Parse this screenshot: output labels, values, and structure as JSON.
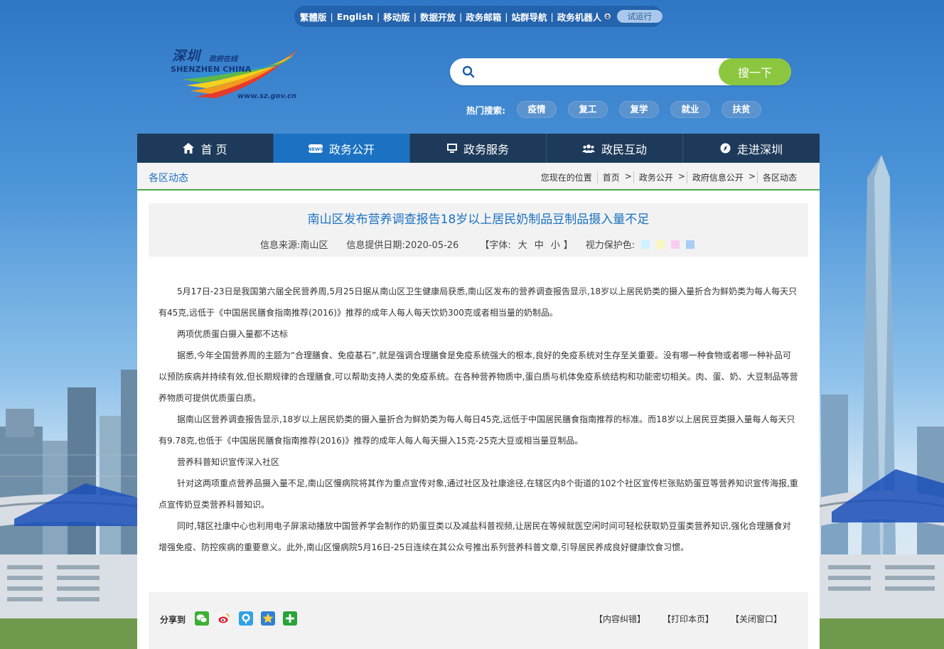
{
  "top_links": {
    "items": [
      "繁體版",
      "English",
      "移动版",
      "数据开放",
      "政务邮箱",
      "站群导航",
      "政务机器人"
    ],
    "trial_badge": "试运行"
  },
  "logo": {
    "chinese_name": "深圳",
    "chinese_sub": "政府在线",
    "english_name": "SHENZHEN CHINA",
    "url": "www.sz.gov.cn"
  },
  "search": {
    "value": "",
    "placeholder": "",
    "button_label": "搜一下",
    "hot_label": "热门搜索:",
    "hot_tags": [
      "疫情",
      "复工",
      "复学",
      "就业",
      "扶贫"
    ]
  },
  "nav": {
    "items": [
      {
        "label": "首 页",
        "icon": "home-icon"
      },
      {
        "label": "政务公开",
        "icon": "news-icon"
      },
      {
        "label": "政务服务",
        "icon": "monitor-icon"
      },
      {
        "label": "政民互动",
        "icon": "people-icon"
      },
      {
        "label": "走进深圳",
        "icon": "compass-icon"
      }
    ],
    "active_index": 1
  },
  "section": {
    "title": "各区动态",
    "breadcrumb_label": "您现在的位置",
    "breadcrumb": [
      "首页",
      "政务公开",
      "政府信息公开",
      "各区动态"
    ]
  },
  "article": {
    "title": "南山区发布营养调查报告18岁以上居民奶制品豆制品摄入量不足",
    "source": "信息来源:南山区",
    "date": "信息提供日期:2020-05-26",
    "font_label": "【字体:",
    "font_sizes": [
      "大",
      "中",
      "小"
    ],
    "font_close": "】",
    "eye_label": "视力保护色:",
    "eye_colors": [
      "#ccf3ff",
      "#f8f7c2",
      "#f9cdf3",
      "#a8cdf5"
    ],
    "paragraphs": [
      "5月17日-23日是我国第六届全民营养周,5月25日据从南山区卫生健康局获悉,南山区发布的营养调查报告显示,18岁以上居民奶类的摄入量折合为鲜奶类为每人每天只有45克,远低于《中国居民膳食指南推荐(2016)》推荐的成年人每人每天饮奶300克或者相当量的奶制品。",
      "两项优质蛋白摄入量都不达标",
      "据悉,今年全国营养周的主题为“合理膳食、免疫基石”,就是强调合理膳食是免疫系统强大的根本,良好的免疫系统对生存至关重要。没有哪一种食物或者哪一种补品可以预防疾病并持续有效,但长期规律的合理膳食,可以帮助支持人类的免疫系统。在各种营养物质中,蛋白质与机体免疫系统结构和功能密切相关。肉、蛋、奶、大豆制品等营养物质可提供优质蛋白质。",
      "据南山区营养调查报告显示,18岁以上居民奶类的摄入量折合为鲜奶类为每人每日45克,远低于中国居民膳食指南推荐的标准。而18岁以上居民豆类摄入量每人每天只有9.78克,也低于《中国居民膳食指南推荐(2016)》推荐的成年人每人每天摄入15克-25克大豆或相当量豆制品。",
      "营养科普知识宣传深入社区",
      "针对这两项重点营养品摄入量不足,南山区慢病院将其作为重点宣传对象,通过社区及社康途径,在辖区内8个街道的102个社区宣传栏张贴奶蛋豆等营养知识宣传海报,重点宣传奶豆类营养科普知识。",
      "同时,辖区社康中心也利用电子屏滚动播放中国营养学会制作的奶蛋豆类以及减盐科普视频,让居民在等候就医空闲时间可轻松获取奶豆蛋类营养知识,强化合理膳食对增强免疫、防控疾病的重要意义。此外,南山区慢病院5月16日-25日连续在其公众号推出系列营养科普文章,引导居民养成良好健康饮食习惯。"
    ]
  },
  "share": {
    "label": "分享到",
    "icons": [
      "wechat-icon",
      "weibo-icon",
      "qzone-icon",
      "star-icon",
      "plus-icon"
    ],
    "links": [
      "【内容纠错】",
      "【打印本页】",
      "【关闭窗口】"
    ]
  }
}
